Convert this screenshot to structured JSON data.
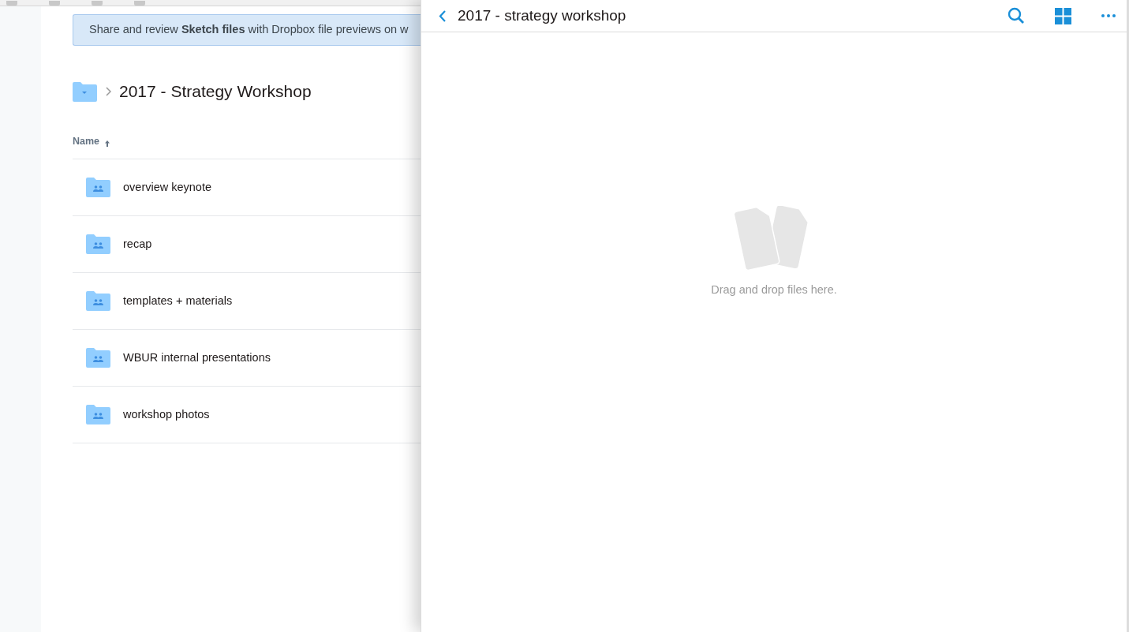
{
  "banner": {
    "text": "Share and review **Sketch files** with Dropbox file previews on w"
  },
  "breadcrumb": {
    "title": "2017 - Strategy Workshop"
  },
  "table": {
    "columns": [
      {
        "label": "Name",
        "sorted": true
      }
    ],
    "rows": [
      {
        "name": "overview keynote"
      },
      {
        "name": "recap"
      },
      {
        "name": "templates + materials"
      },
      {
        "name": "WBUR internal presentations"
      },
      {
        "name": "workshop photos"
      }
    ]
  },
  "panel": {
    "title": "2017 - strategy workshop",
    "empty_message": "Drag and drop files here."
  }
}
